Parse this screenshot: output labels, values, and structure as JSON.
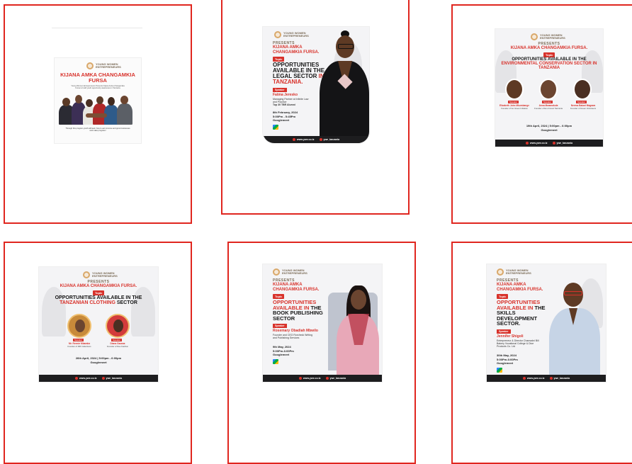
{
  "brand": {
    "org_lines": "YOUNG WOMEN ENTREPRENEURS",
    "presents": "PRESENTS",
    "series": "KIJANA AMKA CHANGAMKIA FURSA.",
    "series_no_dot": "KIJANA AMKA CHANGAMKIA FURSA",
    "tag": "Topic",
    "speaker_label": "Speaker",
    "platform": "Googlemeet",
    "web": "www.ywe.co.tz",
    "handle": "ywe_tanzania"
  },
  "posters": [
    {
      "title": "KIJANA AMKA CHANGAMKIA FURSA",
      "intro": "Young Women Entrepreneurs Presents Kijana Amka Changamkia Fursa to build youth opportunity awareness in Tanzania",
      "caption": "Through this program youth will learn how to earn income and grow businesses and make progress!"
    },
    {
      "title_a": "OPPORTUNITIES AVAILABLE IN THE LEGAL SECTOR ",
      "title_b": "IN TANZANIA.",
      "speaker": "Fatma Jeresko",
      "role": "Managing Partner at Infinite Law and Practice",
      "extra": "Top 30 TBR Alumni",
      "date": "8th February, 2024",
      "time": "5:00Pm - 5:45Pm"
    },
    {
      "title_a": "OPPORTUNITIES AVAILABLE IN THE ",
      "title_b": "ENVIRONMENTAL CONSERVATION SECTOR IN TANZANIA",
      "speakers": [
        {
          "name": "Elizabeth John Mkumbange",
          "role": "Founder of Go Green Initiative"
        },
        {
          "name": "Anna Mwamakula",
          "role": "Founder of Eco Forest Tanzania"
        },
        {
          "name": "Neema Bakari Magawa",
          "role": "Founder of Green Volunteers"
        }
      ],
      "datetime": "19th April, 2024 | 5:00pm - 6:00pm"
    },
    {
      "title_a": "OPPORTUNITIES AVAILABLE IN THE ",
      "title_b": "TANZANIAN CLOTHING ",
      "title_c": "SECTOR",
      "speakers": [
        {
          "name": "Mr. Rennie Mbaraka",
          "role": "Founder of RM Collections"
        },
        {
          "name": "Diana Gazana",
          "role": "Founder of Dee Fashion"
        }
      ],
      "datetime": "26th April, 2024 | 5:00pm - 6:00pm"
    },
    {
      "title_a": "OPPORTUNITIES AVAILABLE IN ",
      "title_b": "THE BOOK PUBLISHING SECTOR",
      "speaker": "Rosemary Obadiah Mbwilo",
      "role": "Founder and CEO Rorcheck Writing and Publishing Services",
      "date": "9th May, 2024",
      "time": "5:00Pm-6:00Pm"
    },
    {
      "title_a": "OPPORTUNITIES AVAILABLE IN ",
      "title_b": "THE SKILLS DEVELOPMENT SECTOR.",
      "speaker": "Jennifer Shigoli",
      "role": "Entrepreneur & Director Chamadni Bill Bakery Vocational College & Dice Products Co. Ltd",
      "date": "30th May, 2024",
      "time": "5:00Pm-6:00Pm"
    }
  ],
  "colors": {
    "frame": "#e0261f",
    "accent": "#d8322b",
    "dark": "#1d1d1f"
  }
}
